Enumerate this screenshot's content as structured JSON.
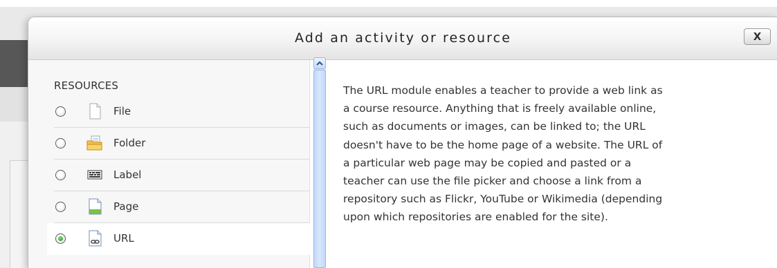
{
  "dialog": {
    "title": "Add an activity or resource",
    "close_label": "X"
  },
  "options": {
    "section_title": "RESOURCES",
    "items": [
      {
        "label": "File",
        "icon": "file-icon",
        "selected": false
      },
      {
        "label": "Folder",
        "icon": "folder-icon",
        "selected": false
      },
      {
        "label": "Label",
        "icon": "label-icon",
        "selected": false
      },
      {
        "label": "Page",
        "icon": "page-icon",
        "selected": false
      },
      {
        "label": "URL",
        "icon": "url-icon",
        "selected": true
      }
    ]
  },
  "description": {
    "lines": [
      "The URL module enables a teacher to provide a web link as",
      "a course resource. Anything that is freely available online,",
      "such as documents or images, can be linked to; the URL",
      "doesn't have to be the home page of a website. The URL of",
      "a particular web page may be copied and pasted or a",
      "teacher can use the file picker and choose a link from a",
      "repository such as Flickr, YouTube or Wikimedia (depending",
      "upon which repositories are enabled for the site)."
    ]
  },
  "colors": {
    "scrollbar": "#d6e6fb",
    "radio_selected": "#1a8f1a",
    "header_border": "#c9c9c9"
  }
}
